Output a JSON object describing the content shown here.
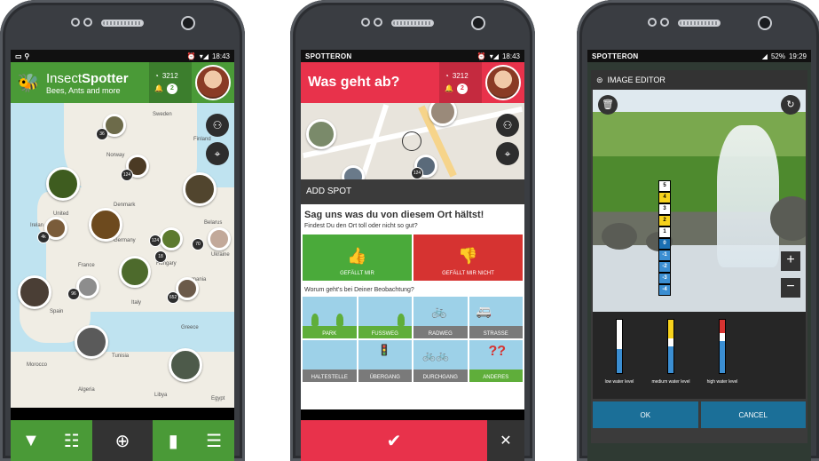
{
  "phone1": {
    "status": {
      "time": "18:43"
    },
    "app_name_light": "Insect",
    "app_name_bold": "Spotter",
    "subtitle": "Bees, Ants and more",
    "stats": {
      "points": "3212",
      "notifications": "2"
    },
    "map_labels": {
      "sweden": "Sweden",
      "finland": "Finland",
      "norway": "Norway",
      "denmark": "Denmark",
      "ireland": "Irelan",
      "united": "United",
      "germany": "Germany",
      "belarus": "Belarus",
      "ukraine": "Ukraine",
      "france": "France",
      "hungary": "Hungary",
      "mania": "mania",
      "spain": "Spain",
      "italy": "Italy",
      "greece": "Greece",
      "tunisia": "Tunisia",
      "morocco": "Morocco",
      "algeria": "Algeria",
      "libya": "Libya",
      "egypt": "Egypt"
    },
    "cluster_counts": [
      "36",
      "124",
      "4k",
      "124",
      "70",
      "18",
      "96",
      "652"
    ],
    "bottom_nav": [
      "filter-icon",
      "list-icon",
      "add-spot-icon",
      "stats-icon",
      "menu-icon"
    ]
  },
  "phone2": {
    "status": {
      "brand": "SPOTTERON",
      "time": "18:43"
    },
    "header_title": "Was geht ab?",
    "stats": {
      "points": "3212",
      "notifications": "2"
    },
    "map_badge": "124",
    "section_title": "ADD SPOT",
    "question1": "Sag uns was du von diesem Ort hältst!",
    "question1_sub": "Findest Du den Ort toll oder nicht so gut?",
    "like_label": "GEFÄLLT MIR",
    "dislike_label": "GEFÄLLT MIR NICHT",
    "question2": "Worum geht's bei Deiner Beobachtung?",
    "categories": [
      "PARK",
      "FUSSWEG",
      "RADWEG",
      "STRASSE",
      "HALTESTELLE",
      "ÜBERGANG",
      "DURCHGANG",
      "ANDERES"
    ]
  },
  "phone3": {
    "status": {
      "brand": "SPOTTERON",
      "battery": "52%",
      "time": "19:29"
    },
    "dialog_title": "IMAGE EDITOR",
    "ruler_values": [
      "5",
      "4",
      "3",
      "2",
      "1",
      "0",
      "-1",
      "-2",
      "-3",
      "-4"
    ],
    "levels": [
      "low water level",
      "medium water level",
      "high water level"
    ],
    "ok_label": "OK",
    "cancel_label": "CANCEL"
  }
}
